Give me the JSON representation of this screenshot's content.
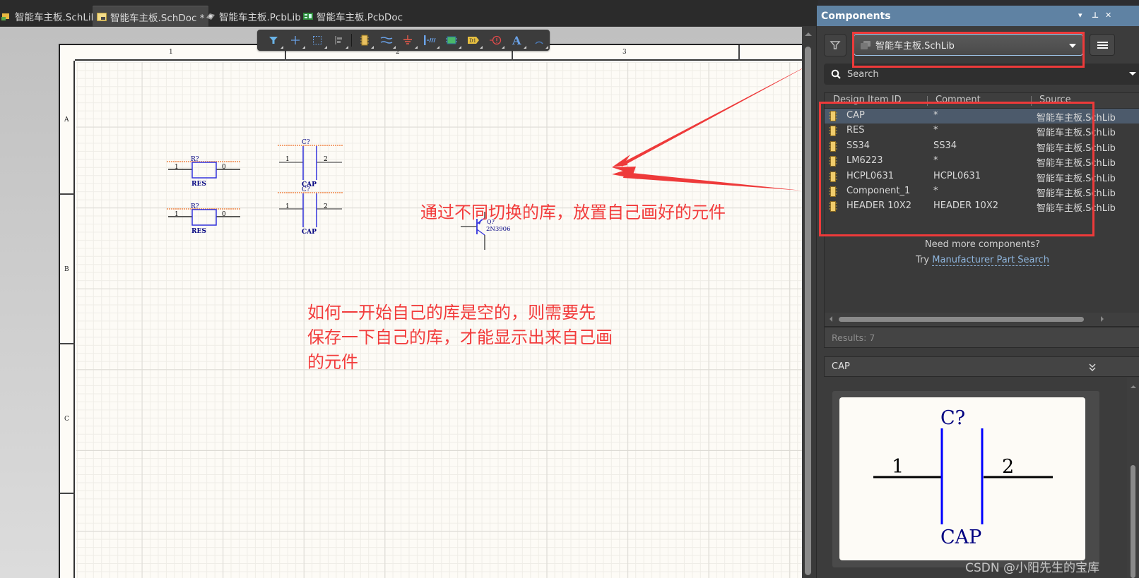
{
  "tabs": [
    {
      "label": "智能车主板.SchLib",
      "icon": "schlib-icon",
      "active": false
    },
    {
      "label": "智能车主板.SchDoc *",
      "icon": "schdoc-icon",
      "active": true
    },
    {
      "label": "智能车主板.PcbLib",
      "icon": "pcblib-icon",
      "active": false
    },
    {
      "label": "智能车主板.PcbDoc",
      "icon": "pcbdoc-icon",
      "active": false
    }
  ],
  "toolbar": {
    "buttons": [
      "filter-icon",
      "crosshair-icon",
      "selection-rect-icon",
      "align-icon",
      "component-icon",
      "wire-bus-icon",
      "ground-power-icon",
      "bus-entry-icon",
      "sheet-symbol-icon",
      "port-icon",
      "no-erc-icon",
      "text-icon",
      "arc-icon"
    ]
  },
  "sheet": {
    "columns": [
      "1",
      "2",
      "3"
    ],
    "rows": [
      "A",
      "B",
      "C"
    ]
  },
  "schematic": {
    "res1": {
      "designator": "R?",
      "comment": "RES",
      "pin1": "1",
      "pin2": "0"
    },
    "res2": {
      "designator": "R?",
      "comment": "RES",
      "pin1": "1",
      "pin2": "0"
    },
    "cap1": {
      "designator": "C?",
      "comment": "CAP",
      "pin1": "1",
      "pin2": "2"
    },
    "cap2": {
      "designator": "C?",
      "comment": "CAP",
      "pin1": "1",
      "pin2": "2"
    },
    "transistor": {
      "designator": "Q?",
      "comment": "2N3906"
    }
  },
  "annotations": {
    "note1": "通过不同切换的库，放置自己画好的元件",
    "note2_lines": [
      "如何一开始自己的库是空的，则需要先",
      "保存一下自己的库，才能显示出来自己画",
      "的元件"
    ]
  },
  "panel": {
    "title": "Components",
    "library": "智能车主板.SchLib",
    "search_placeholder": "Search",
    "columns": [
      "Design Item ID",
      "Comment",
      "Source"
    ],
    "rows": [
      {
        "id": "CAP",
        "comment": "*",
        "source": "智能车主板.SchLib",
        "selected": true
      },
      {
        "id": "RES",
        "comment": "*",
        "source": "智能车主板.SchLib"
      },
      {
        "id": "SS34",
        "comment": "SS34",
        "source": "智能车主板.SchLib"
      },
      {
        "id": "LM6223",
        "comment": "*",
        "source": "智能车主板.SchLib"
      },
      {
        "id": "HCPL0631",
        "comment": "HCPL0631",
        "source": "智能车主板.SchLib"
      },
      {
        "id": "Component_1",
        "comment": "*",
        "source": "智能车主板.SchLib"
      },
      {
        "id": "HEADER 10X2",
        "comment": "HEADER 10X2",
        "source": "智能车主板.SchLib"
      }
    ],
    "need_more": "Need more components?",
    "try_label": "Try",
    "mps_link": "Manufacturer Part Search",
    "results": "Results: 7",
    "detail_title": "CAP",
    "preview": {
      "designator": "C?",
      "comment": "CAP",
      "pin1": "1",
      "pin2": "2"
    }
  },
  "watermark": "CSDN @小阳先生的宝库",
  "colors": {
    "annotation": "#f23c3c",
    "panel_header": "#5f82a3",
    "symbol_blue": "#0000ff",
    "label_navy": "#000080"
  }
}
